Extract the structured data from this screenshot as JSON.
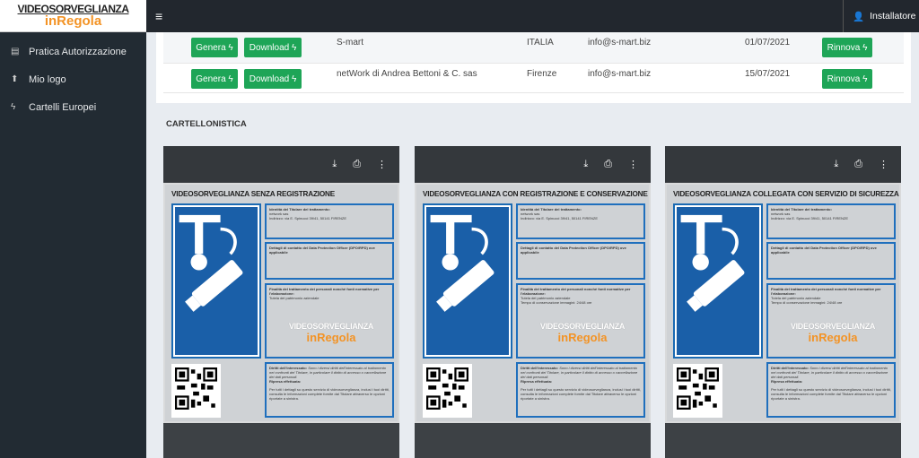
{
  "logo": {
    "line1": "VIDEOSORVEGLIANZA",
    "line2": "inRegola"
  },
  "sidebar": {
    "items": [
      {
        "icon": "document-icon",
        "glyph": "▤",
        "label": "Pratica Autorizzazione"
      },
      {
        "icon": "upload-icon",
        "glyph": "⬆",
        "label": "Mio logo"
      },
      {
        "icon": "bolt-icon",
        "glyph": "ϟ",
        "label": "Cartelli Europei"
      }
    ]
  },
  "topbar": {
    "menu_glyph": "≡",
    "user_glyph": "👤",
    "user": "Installatore"
  },
  "table": {
    "rows": [
      {
        "genera": "Genera ϟ",
        "download": "Download ϟ",
        "name": "S-mart",
        "city": "ITALIA",
        "email": "info@s-mart.biz",
        "date": "01/07/2021",
        "rinnova": "Rinnova ϟ"
      },
      {
        "genera": "Genera ϟ",
        "download": "Download ϟ",
        "name": "netWork di Andrea Bettoni & C. sas",
        "city": "Firenze",
        "email": "info@s-mart.biz",
        "date": "15/07/2021",
        "rinnova": "Rinnova ϟ"
      }
    ]
  },
  "section_title": "CARTELLONISTICA",
  "tools": {
    "download": "⤓",
    "print": "⎙",
    "more": "⋮"
  },
  "sign_common": {
    "b1_title": "Identità del Titolare del trattamento:",
    "b1_l1": "network sas",
    "b1_l2": "Indirizzo: via E. Spinucci 39/41, 50141 FIRENZE",
    "b2_title": "Dettagli di contatto del Data Protection Officer (DPO/RPD) ove applicabile",
    "b3_title": "Finalità del trattamento dei personali nonché fonti normative per l'elaborazione:",
    "b3_l1": "Tutela del patrimonio aziendale",
    "b4_title": "Diritti dell'interessato:",
    "b4_text": "Sono i diversi diritti dell'interessato al trattamento nei confronti del Titolare, in particolare il diritto di accesso o cancellazione dei dati personali.",
    "b4_ripresa": "Ripresa effettuata:",
    "b4_more": "Per tutti i dettagli su questo servizio di videosorveglianza, inclusi i tuoi diritti, consulta le informazioni complete fornite dal Titolare attraverso le opzioni riportate a sinistra.",
    "wm1": "VIDEOSORVEGLIANZA",
    "wm2": "inRegola"
  },
  "cards": [
    {
      "title": "VIDEOSORVEGLIANZA SENZA REGISTRAZIONE",
      "retention": ""
    },
    {
      "title": "VIDEOSORVEGLIANZA CON REGISTRAZIONE E CONSERVAZIONE",
      "retention": "Tempo di conservazione immagini: 24/48 ore"
    },
    {
      "title": "VIDEOSORVEGLIANZA COLLEGATA CON SERVIZIO DI SICUREZZA",
      "retention": "Tempo di conservazione immagini: 24/48 ore"
    }
  ],
  "colors": {
    "green": "#1ea557",
    "sidebar": "#222b33",
    "blue": "#1a5fa8",
    "orange": "#f39325"
  }
}
